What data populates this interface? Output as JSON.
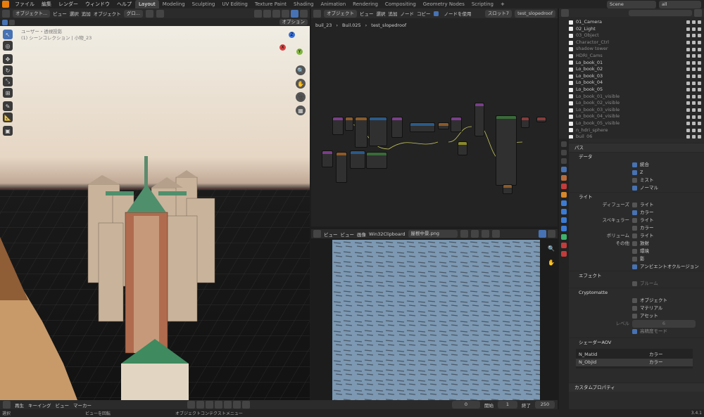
{
  "topbar": {
    "menus": [
      "ファイル",
      "編集",
      "レンダー",
      "ウィンドウ",
      "ヘルプ"
    ],
    "workspaces": [
      "Layout",
      "Modeling",
      "Sculpting",
      "UV Editing",
      "Texture Paint",
      "Shading",
      "Animation",
      "Rendering",
      "Compositing",
      "Geometry Nodes",
      "Scripting"
    ],
    "active_workspace": "Layout",
    "scene": "Scene",
    "layer": "all"
  },
  "viewport": {
    "mode": "オブジェクト...",
    "menus": [
      "ビュー",
      "選択",
      "追加",
      "オブジェクト"
    ],
    "orientation": "グロ...",
    "options": "オプション",
    "overlay_text1": "ユーザー・透視投影",
    "overlay_text2": "(1) シーンコレクション | 小物_23",
    "gizmo": {
      "x": "X",
      "y": "Y",
      "z": "Z"
    }
  },
  "node_editor": {
    "mode": "オブジェクト",
    "menus": [
      "ビュー",
      "選択",
      "追加",
      "ノード",
      "コピー"
    ],
    "use_nodes": "ノードを使用",
    "slot": "スロット7",
    "material": "test_slopedroof",
    "breadcrumb": [
      "buil_23",
      "Buil.025",
      "test_slopedroof"
    ]
  },
  "image_editor": {
    "menus": [
      "ビュー",
      "ビュー",
      "画像"
    ],
    "clipboard": "Win32Clipboard",
    "image_name": "屋根中景.png"
  },
  "outliner": {
    "items": [
      {
        "name": "01_Camera",
        "dim": false
      },
      {
        "name": "02_Light",
        "dim": false
      },
      {
        "name": "03_Object",
        "dim": true
      },
      {
        "name": "Charactor_Ctrl",
        "dim": true
      },
      {
        "name": "shadow tower",
        "dim": true
      },
      {
        "name": "HDRI_Cams",
        "dim": true
      },
      {
        "name": "Lo_book_01",
        "dim": false
      },
      {
        "name": "Lo_book_02",
        "dim": false
      },
      {
        "name": "Lo_book_03",
        "dim": false
      },
      {
        "name": "Lo_book_04",
        "dim": false
      },
      {
        "name": "Lo_book_05",
        "dim": false
      },
      {
        "name": "Lo_book_01_visible",
        "dim": true
      },
      {
        "name": "Lo_book_02_visible",
        "dim": true
      },
      {
        "name": "Lo_book_03_visible",
        "dim": true
      },
      {
        "name": "Lo_book_04_visible",
        "dim": true
      },
      {
        "name": "Lo_book_05_visible",
        "dim": true
      },
      {
        "name": "n_hdri_sphere",
        "dim": true
      },
      {
        "name": "buil_06",
        "dim": true
      }
    ]
  },
  "properties": {
    "passes": "パス",
    "data": "データ",
    "data_items": [
      {
        "label": "統合",
        "on": true
      },
      {
        "label": "Z",
        "on": true
      },
      {
        "label": "ミスト",
        "on": false
      },
      {
        "label": "ノーマル",
        "on": true
      }
    ],
    "light": "ライト",
    "diffuse_label": "ディフューズ",
    "diffuse_items": [
      {
        "label": "ライト",
        "on": false
      },
      {
        "label": "カラー",
        "on": true
      }
    ],
    "specular_label": "スペキュラー",
    "specular_items": [
      {
        "label": "ライト",
        "on": false
      },
      {
        "label": "カラー",
        "on": false
      }
    ],
    "volume_label": "ボリューム",
    "volume_items": [
      {
        "label": "ライト",
        "on": false
      }
    ],
    "other_label": "その他",
    "other_items": [
      {
        "label": "放射",
        "on": false
      },
      {
        "label": "環境",
        "on": false
      },
      {
        "label": "影",
        "on": false
      },
      {
        "label": "アンビエントオクルージョン",
        "on": true
      }
    ],
    "effects": "エフェクト",
    "bloom": "ブルーム",
    "crypto": "Cryptomatte",
    "crypto_items": [
      {
        "label": "オブジェクト",
        "on": false
      },
      {
        "label": "マテリアル",
        "on": false
      },
      {
        "label": "アセット",
        "on": false
      }
    ],
    "levels_label": "レベル",
    "levels_value": "6",
    "high_precision": "高精度モード",
    "aov": "シェーダーAOV",
    "aov_rows": [
      {
        "name": "N_MatId",
        "type": "カラー"
      },
      {
        "name": "N_ObjId",
        "type": "カラー"
      }
    ],
    "custom_props": "カスタムプロパティ"
  },
  "timeline": {
    "menus": [
      "再生",
      "キーイング",
      "ビュー",
      "マーカー"
    ],
    "current_frame": "0",
    "start_label": "開始",
    "start": "1",
    "end_label": "終了",
    "end": "250"
  },
  "statusbar": {
    "select": "選択",
    "view": "ビューを回転",
    "context": "オブジェクトコンテクストメニュー",
    "version": "3.4.1"
  }
}
